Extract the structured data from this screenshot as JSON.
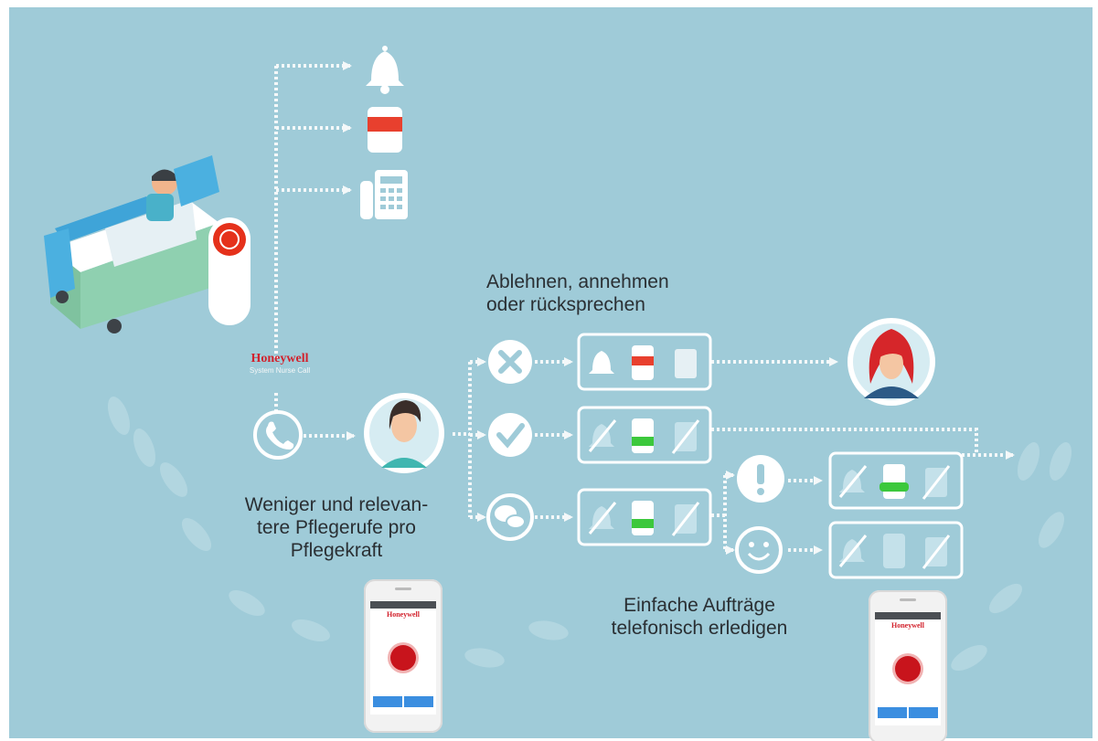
{
  "diagram": {
    "colors": {
      "background": "#9fcbd8",
      "line": "#f4f8f9",
      "brand_red": "#d2222d",
      "signal_green": "#3cc83c",
      "text": "#2a2f33"
    },
    "caption_left": [
      "Weniger und relevan-",
      "tere Pflegerufe pro",
      "Pflegekraft"
    ],
    "caption_top": [
      "Ablehnen, annehmen",
      "oder rücksprechen"
    ],
    "caption_bottom": [
      "Einfache Aufträge",
      "telefonisch erledigen"
    ],
    "brand": {
      "name": "Honeywell",
      "subtitle": "System Nurse Call"
    },
    "phone_logo": "Honeywell",
    "notification_icons": [
      "bell-icon",
      "corridor-lamp-icon",
      "desk-phone-icon"
    ],
    "response_options": [
      "reject-x-icon",
      "accept-check-icon",
      "talk-back-bubble-icon"
    ],
    "followup_options": [
      "urgent-exclamation-icon",
      "simple-task-smiley-icon"
    ]
  }
}
